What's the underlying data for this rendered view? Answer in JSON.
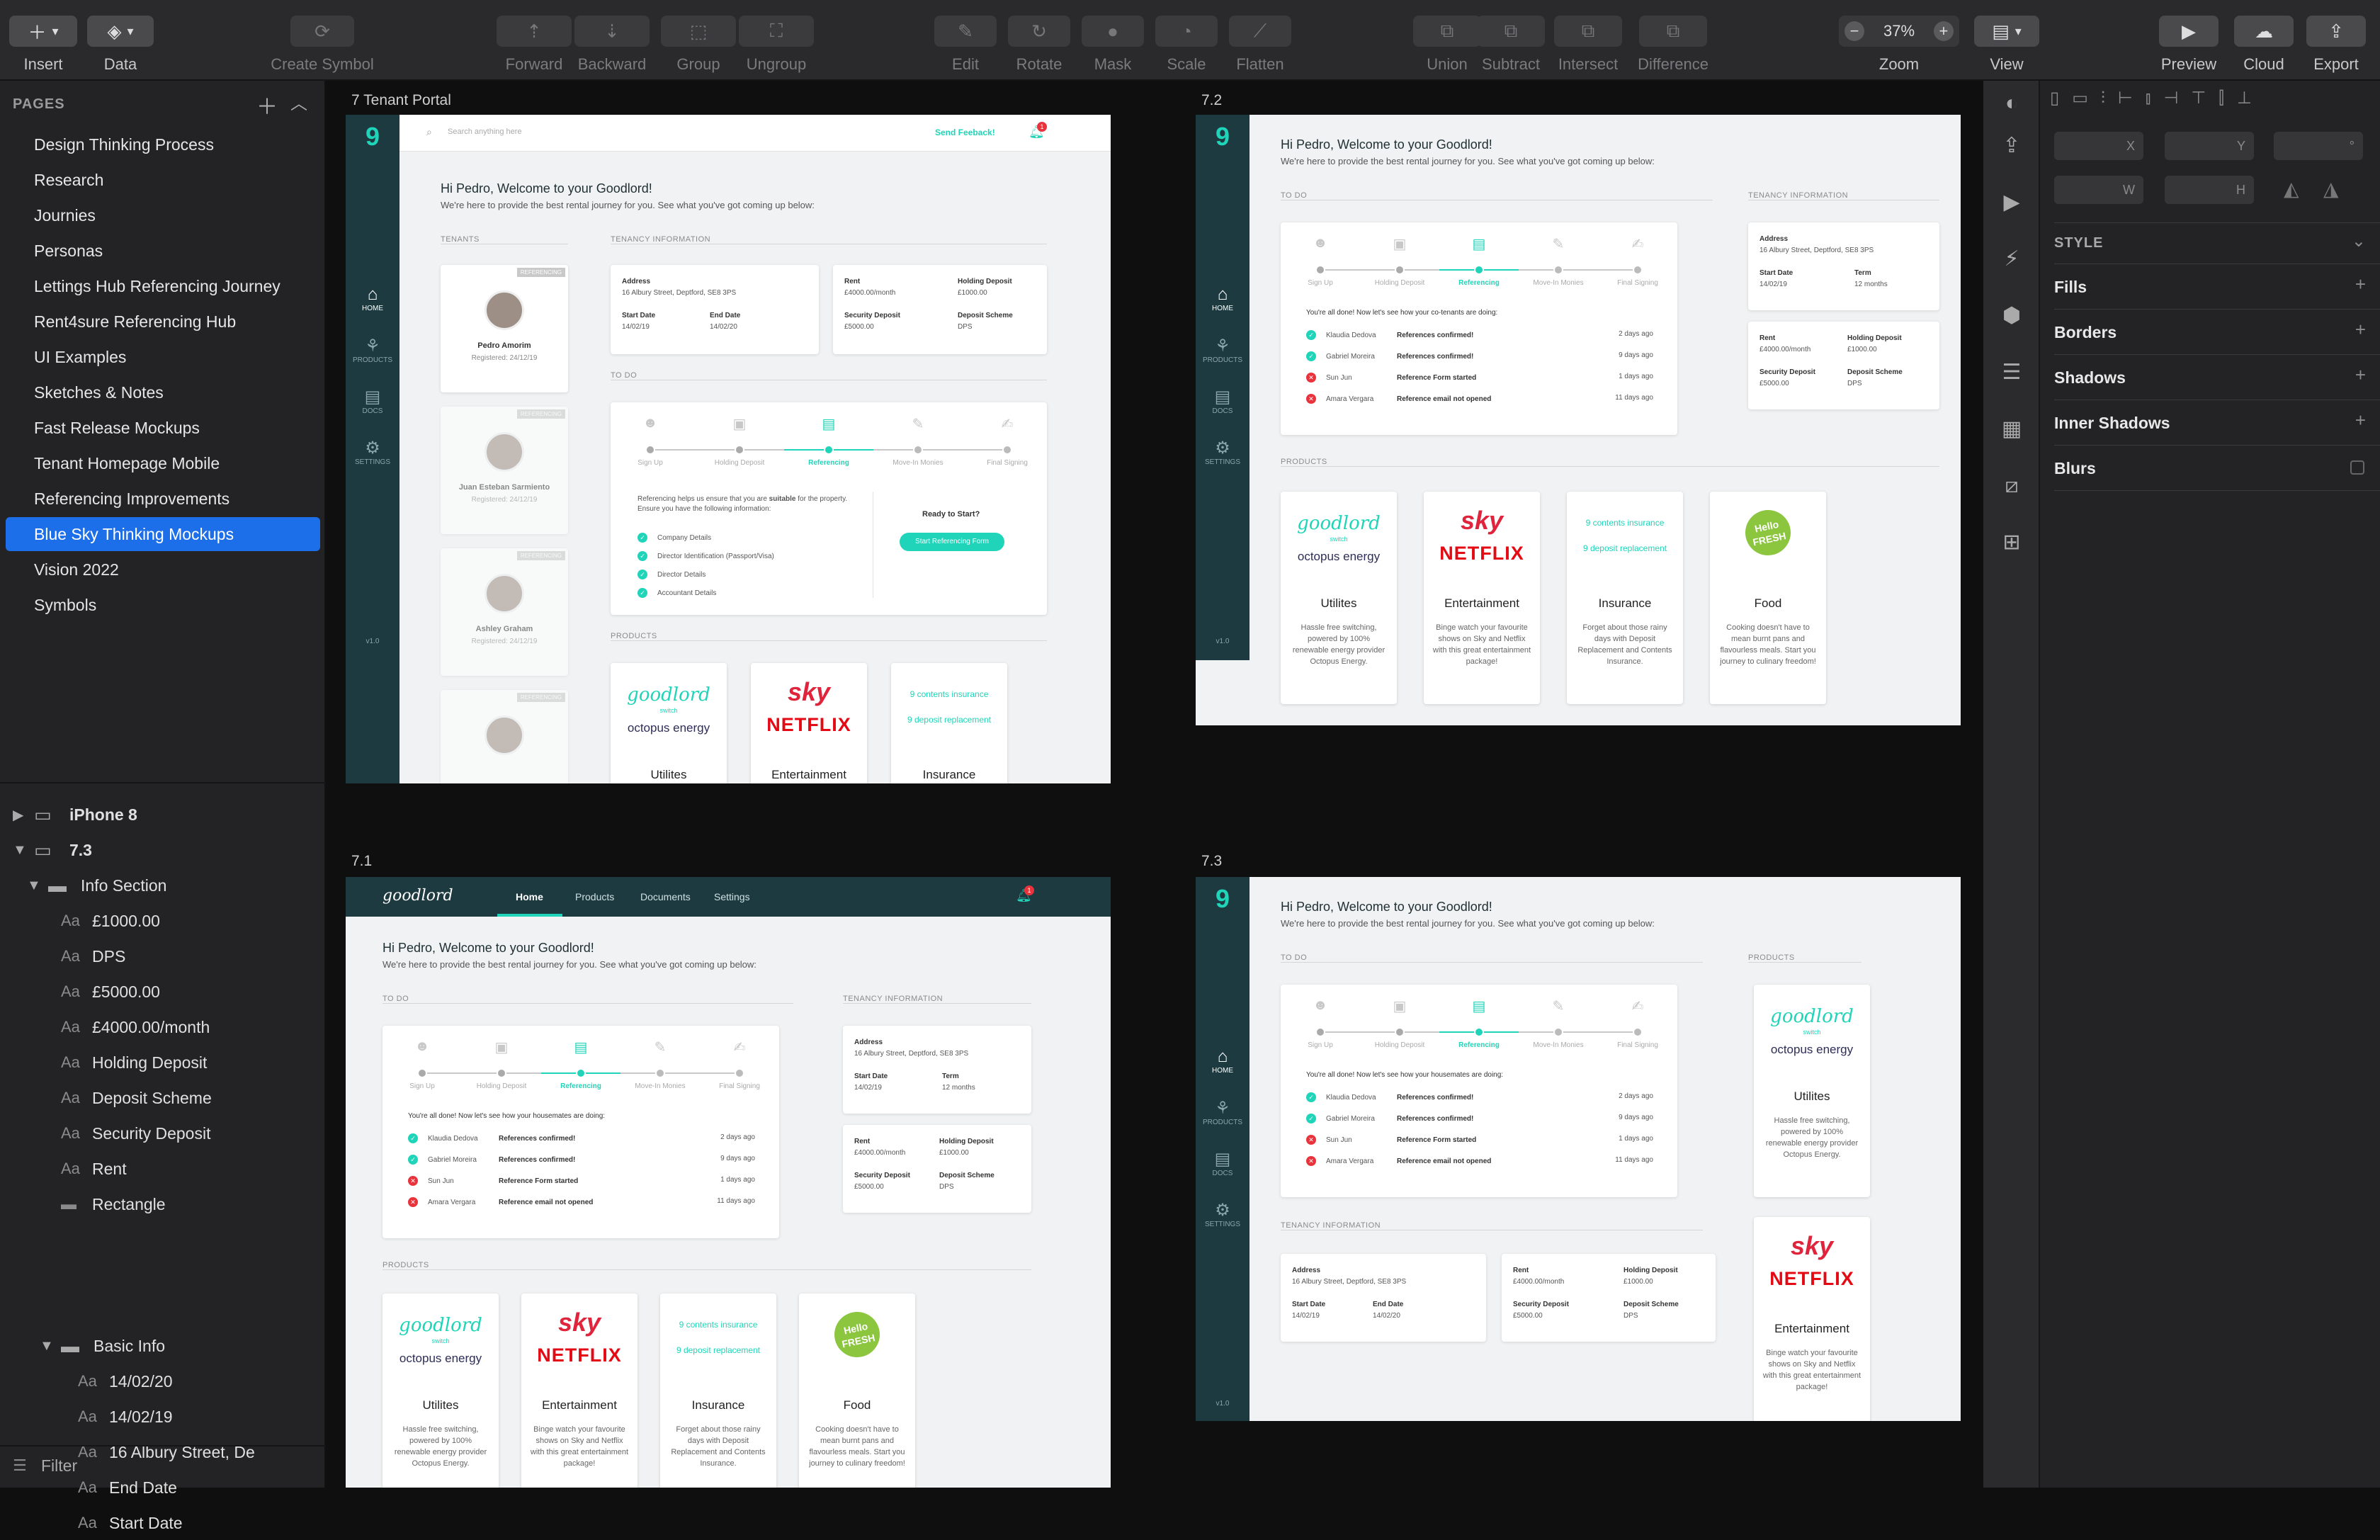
{
  "toolbar": {
    "insert": "Insert",
    "data": "Data",
    "create_symbol": "Create Symbol",
    "forward": "Forward",
    "backward": "Backward",
    "group": "Group",
    "ungroup": "Ungroup",
    "edit": "Edit",
    "rotate": "Rotate",
    "mask": "Mask",
    "scale": "Scale",
    "flatten": "Flatten",
    "union": "Union",
    "subtract": "Subtract",
    "intersect": "Intersect",
    "difference": "Difference",
    "zoom_value": "37%",
    "zoom_minus": "−",
    "zoom_plus": "+",
    "zoom": "Zoom",
    "view": "View",
    "preview": "Preview",
    "cloud": "Cloud",
    "export": "Export"
  },
  "pages": {
    "header": "PAGES",
    "items": [
      "Design Thinking Process",
      "Research",
      "Journies",
      "Personas",
      "Lettings Hub Referencing Journey",
      "Rent4sure Referencing Hub",
      "UI Examples",
      "Sketches & Notes",
      "Fast Release Mockups",
      "Tenant Homepage Mobile",
      "Referencing Improvements",
      "Blue Sky Thinking Mockups",
      "Vision 2022",
      "Symbols"
    ],
    "selected_index": 11
  },
  "layers": {
    "iphone": "iPhone 8",
    "artboard": "7.3",
    "info_section": "Info Section",
    "info_items": [
      "£1000.00",
      "DPS",
      "£5000.00",
      "£4000.00/month",
      "Holding Deposit",
      "Deposit Scheme",
      "Security Deposit",
      "Rent",
      "Rectangle"
    ],
    "basic_info": "Basic Info",
    "basic_items": [
      "14/02/20",
      "14/02/19",
      "16 Albury Street, De",
      "End Date",
      "Start Date"
    ],
    "filter": "Filter"
  },
  "artboards": {
    "a1_label": "7 Tenant Portal",
    "a2_label": "7.2",
    "a3_label": "7.1",
    "a4_label": "7.3"
  },
  "portal": {
    "search_placeholder": "Search anything here",
    "send_feedback": "Send Feeback!",
    "notif_count": "1",
    "greeting": "Hi Pedro, Welcome to your Goodlord!",
    "subgreeting": "We're here to provide the best rental journey for you. See what you've got coming up below:",
    "tenants": "TENANTS",
    "tenancy_info": "TENANCY INFORMATION",
    "todo": "TO DO",
    "products": "PRODUCTS",
    "nav": {
      "home": "HOME",
      "products": "PRODUCTS",
      "docs": "DOCS",
      "settings": "SETTINGS",
      "version": "v1.0"
    },
    "tenant_list": [
      {
        "name": "Pedro Amorim",
        "reg": "Registered: 24/12/19",
        "badge": "REFERENCING"
      },
      {
        "name": "Juan Esteban Sarmiento",
        "reg": "Registered: 24/12/19",
        "badge": "REFERENCING"
      },
      {
        "name": "Ashley Graham",
        "reg": "Registered: 24/12/19",
        "badge": "REFERENCING"
      },
      {
        "name": "",
        "reg": "",
        "badge": "REFERENCING"
      }
    ],
    "address_k": "Address",
    "address_v": "16 Albury Street, Deptford, SE8 3PS",
    "start_k": "Start Date",
    "start_v": "14/02/19",
    "end_k": "End Date",
    "end_v": "14/02/20",
    "term_k": "Term",
    "term_v": "12 months",
    "rent_k": "Rent",
    "rent_v": "£4000.00/month",
    "holding_k": "Holding Deposit",
    "holding_v": "£1000.00",
    "security_k": "Security Deposit",
    "security_v": "£5000.00",
    "scheme_k": "Deposit Scheme",
    "scheme_v": "DPS",
    "steps": [
      "Sign Up",
      "Holding Deposit",
      "Referencing",
      "Move-In Monies",
      "Final Signing"
    ],
    "ref_intro_a": "Referencing helps us ensure that you are",
    "ref_intro_b": "suitable",
    "ref_intro_c": "for the property. Ensure you have the following information:",
    "ref_list": [
      "Company Details",
      "Director Identification (Passport/Visa)",
      "Director Details",
      "Accountant Details"
    ],
    "ready": "Ready to Start?",
    "start_btn": "Start Referencing Form",
    "done_cotenants": "You're all done! Now let's see how your co-tenants are doing:",
    "done_housemates": "You're all done! Now let's see how your housemates are doing:",
    "status": [
      {
        "name": "Klaudia Dedova",
        "text": "References confirmed!",
        "when": "2 days ago",
        "ok": true
      },
      {
        "name": "Gabriel Moreira",
        "text": "References confirmed!",
        "when": "9 days ago",
        "ok": true
      },
      {
        "name": "Sun Jun",
        "text": "Reference Form started",
        "when": "1 days ago",
        "ok": false
      },
      {
        "name": "Amara Vergara",
        "text": "Reference email not opened",
        "when": "11 days ago",
        "ok": false
      }
    ],
    "topnav": {
      "logo": "goodlord",
      "home": "Home",
      "products": "Products",
      "documents": "Documents",
      "settings": "Settings"
    },
    "product_list": [
      {
        "title": "Utilites",
        "desc": "Hassle free switching, powered by 100% renewable energy provider Octopus Energy.",
        "b1": "goodlord",
        "b1s": "switch",
        "b2": "octopus energy"
      },
      {
        "title": "Entertainment",
        "desc": "Binge watch your favourite shows on Sky and Netflix with this great entertainment package!",
        "b1": "sky",
        "b2": "NETFLIX"
      },
      {
        "title": "Insurance",
        "desc": "Forget about those rainy days with Deposit Replacement and Contents Insurance.",
        "b1": "9 contents insurance",
        "b2": "9 deposit replacement"
      },
      {
        "title": "Food",
        "desc": "Cooking doesn't have to mean burnt pans and flavourless meals. Start you journey to culinary freedom!",
        "b1": "Hello FRESH"
      }
    ]
  },
  "inspector": {
    "x": "X",
    "y": "Y",
    "w": "W",
    "h": "H",
    "style": "STYLE",
    "fills": "Fills",
    "borders": "Borders",
    "shadows": "Shadows",
    "inner_shadows": "Inner Shadows",
    "blurs": "Blurs",
    "plus": "+"
  }
}
